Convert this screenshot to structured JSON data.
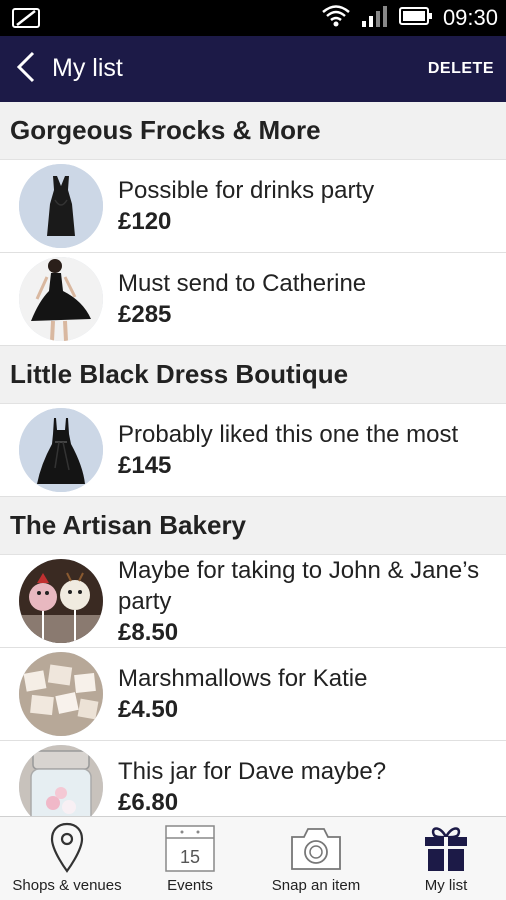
{
  "status_bar": {
    "time": "09:30",
    "icons": [
      "screen-notification-icon",
      "wifi-icon",
      "signal-icon",
      "battery-icon"
    ]
  },
  "app_bar": {
    "title": "My list",
    "delete_label": "DELETE",
    "background": "#1c1a47"
  },
  "sections": [
    {
      "title": "Gorgeous Frocks & More",
      "items": [
        {
          "note": "Possible for drinks party",
          "price": "£120",
          "image": "black-dress-photo"
        },
        {
          "note": "Must send to Catherine",
          "price": "£285",
          "image": "black-dress-photo"
        }
      ]
    },
    {
      "title": "Little Black Dress Boutique",
      "items": [
        {
          "note": "Probably liked this one the most",
          "price": "£145",
          "image": "black-dress-photo"
        }
      ]
    },
    {
      "title": "The Artisan Bakery",
      "items": [
        {
          "note": "Maybe for taking to John & Jane’s party",
          "price": "£8.50",
          "image": "cake-pops-photo"
        },
        {
          "note": "Marshmallows for Katie",
          "price": "£4.50",
          "image": "marshmallows-photo"
        },
        {
          "note": "This jar for Dave maybe?",
          "price": "£6.80",
          "image": "sweet-jar-photo"
        }
      ]
    }
  ],
  "bottom_nav": {
    "items": [
      {
        "label": "Shops & venues",
        "icon": "map-pin-icon",
        "active": false
      },
      {
        "label": "Events",
        "icon": "calendar-icon",
        "calendar_day": "15",
        "active": false
      },
      {
        "label": "Snap an item",
        "icon": "camera-icon",
        "active": false
      },
      {
        "label": "My list",
        "icon": "gift-icon",
        "active": true
      }
    ]
  },
  "colors": {
    "app_bar": "#1c1a47",
    "active_icon": "#1c1a47",
    "section_header_bg": "#f1f1f1"
  }
}
